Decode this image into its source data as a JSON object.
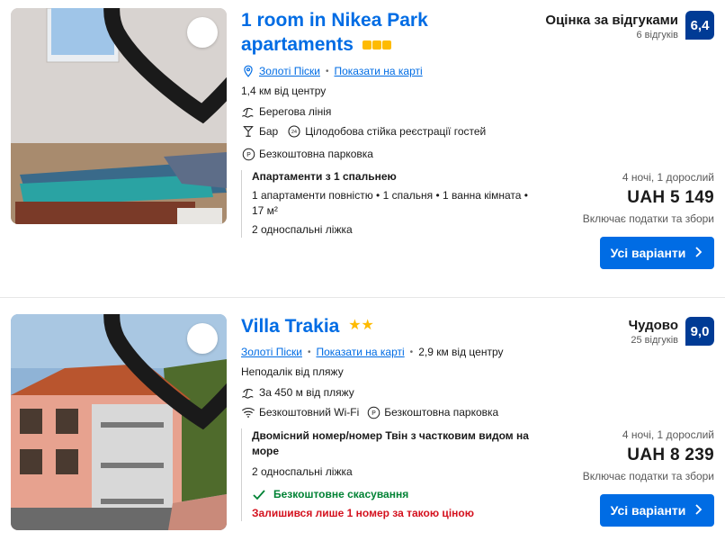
{
  "listings": [
    {
      "title": "1 room in Nikea Park apartaments",
      "location_link": "Золоті Піски",
      "map_link": "Показати на карті",
      "distance": "1,4 км від центру",
      "feature1": "Берегова лінія",
      "feature_bar": "Бар",
      "feature_desk": "Цілодобова стійка реєстрації гостей",
      "feature_parking": "Безкоштовна парковка",
      "score_word": "Оцінка за відгуками",
      "review_count": "6 відгуків",
      "score": "6,4",
      "room_name": "Апартаменти з 1 спальнею",
      "room_details": "1 апартаменти повністю • 1 спальня • 1 ванна кімната • 17 м²",
      "beds": "2 односпальні ліжка",
      "price_meta": "4 ночі, 1 дорослий",
      "price": "UAH 5 149",
      "tax_note": "Включає податки та збори",
      "button": "Усі варіанти"
    },
    {
      "title": "Villa Trakia",
      "location_link": "Золоті Піски",
      "map_link": "Показати на карті",
      "distance": "2,9 км від центру",
      "near_beach": "Неподалік від пляжу",
      "beach_distance": "За 450 м від пляжу",
      "wifi": "Безкоштовний Wi-Fi",
      "feature_parking": "Безкоштовна парковка",
      "score_word": "Чудово",
      "review_count": "25 відгуків",
      "score": "9,0",
      "room_name": "Двомісний номер/номер Твін з частковим видом на море",
      "beds": "2 односпальні ліжка",
      "cancellation": "Безкоштовне скасування",
      "scarcity": "Залишився лише 1 номер за такою ціною",
      "price_meta": "4 ночі, 1 дорослий",
      "price": "UAH 8 239",
      "tax_note": "Включає податки та збори",
      "button": "Усі варіанти"
    }
  ],
  "colors": {
    "link": "#006ce4",
    "score_bg": "#003b95",
    "star": "#febb02",
    "green": "#008234",
    "red": "#d4111e"
  },
  "icons": [
    "heart-icon",
    "pin-icon",
    "beach-icon",
    "bar-icon",
    "reception-icon",
    "parking-icon",
    "wifi-icon",
    "check-icon",
    "chevron-right-icon"
  ]
}
